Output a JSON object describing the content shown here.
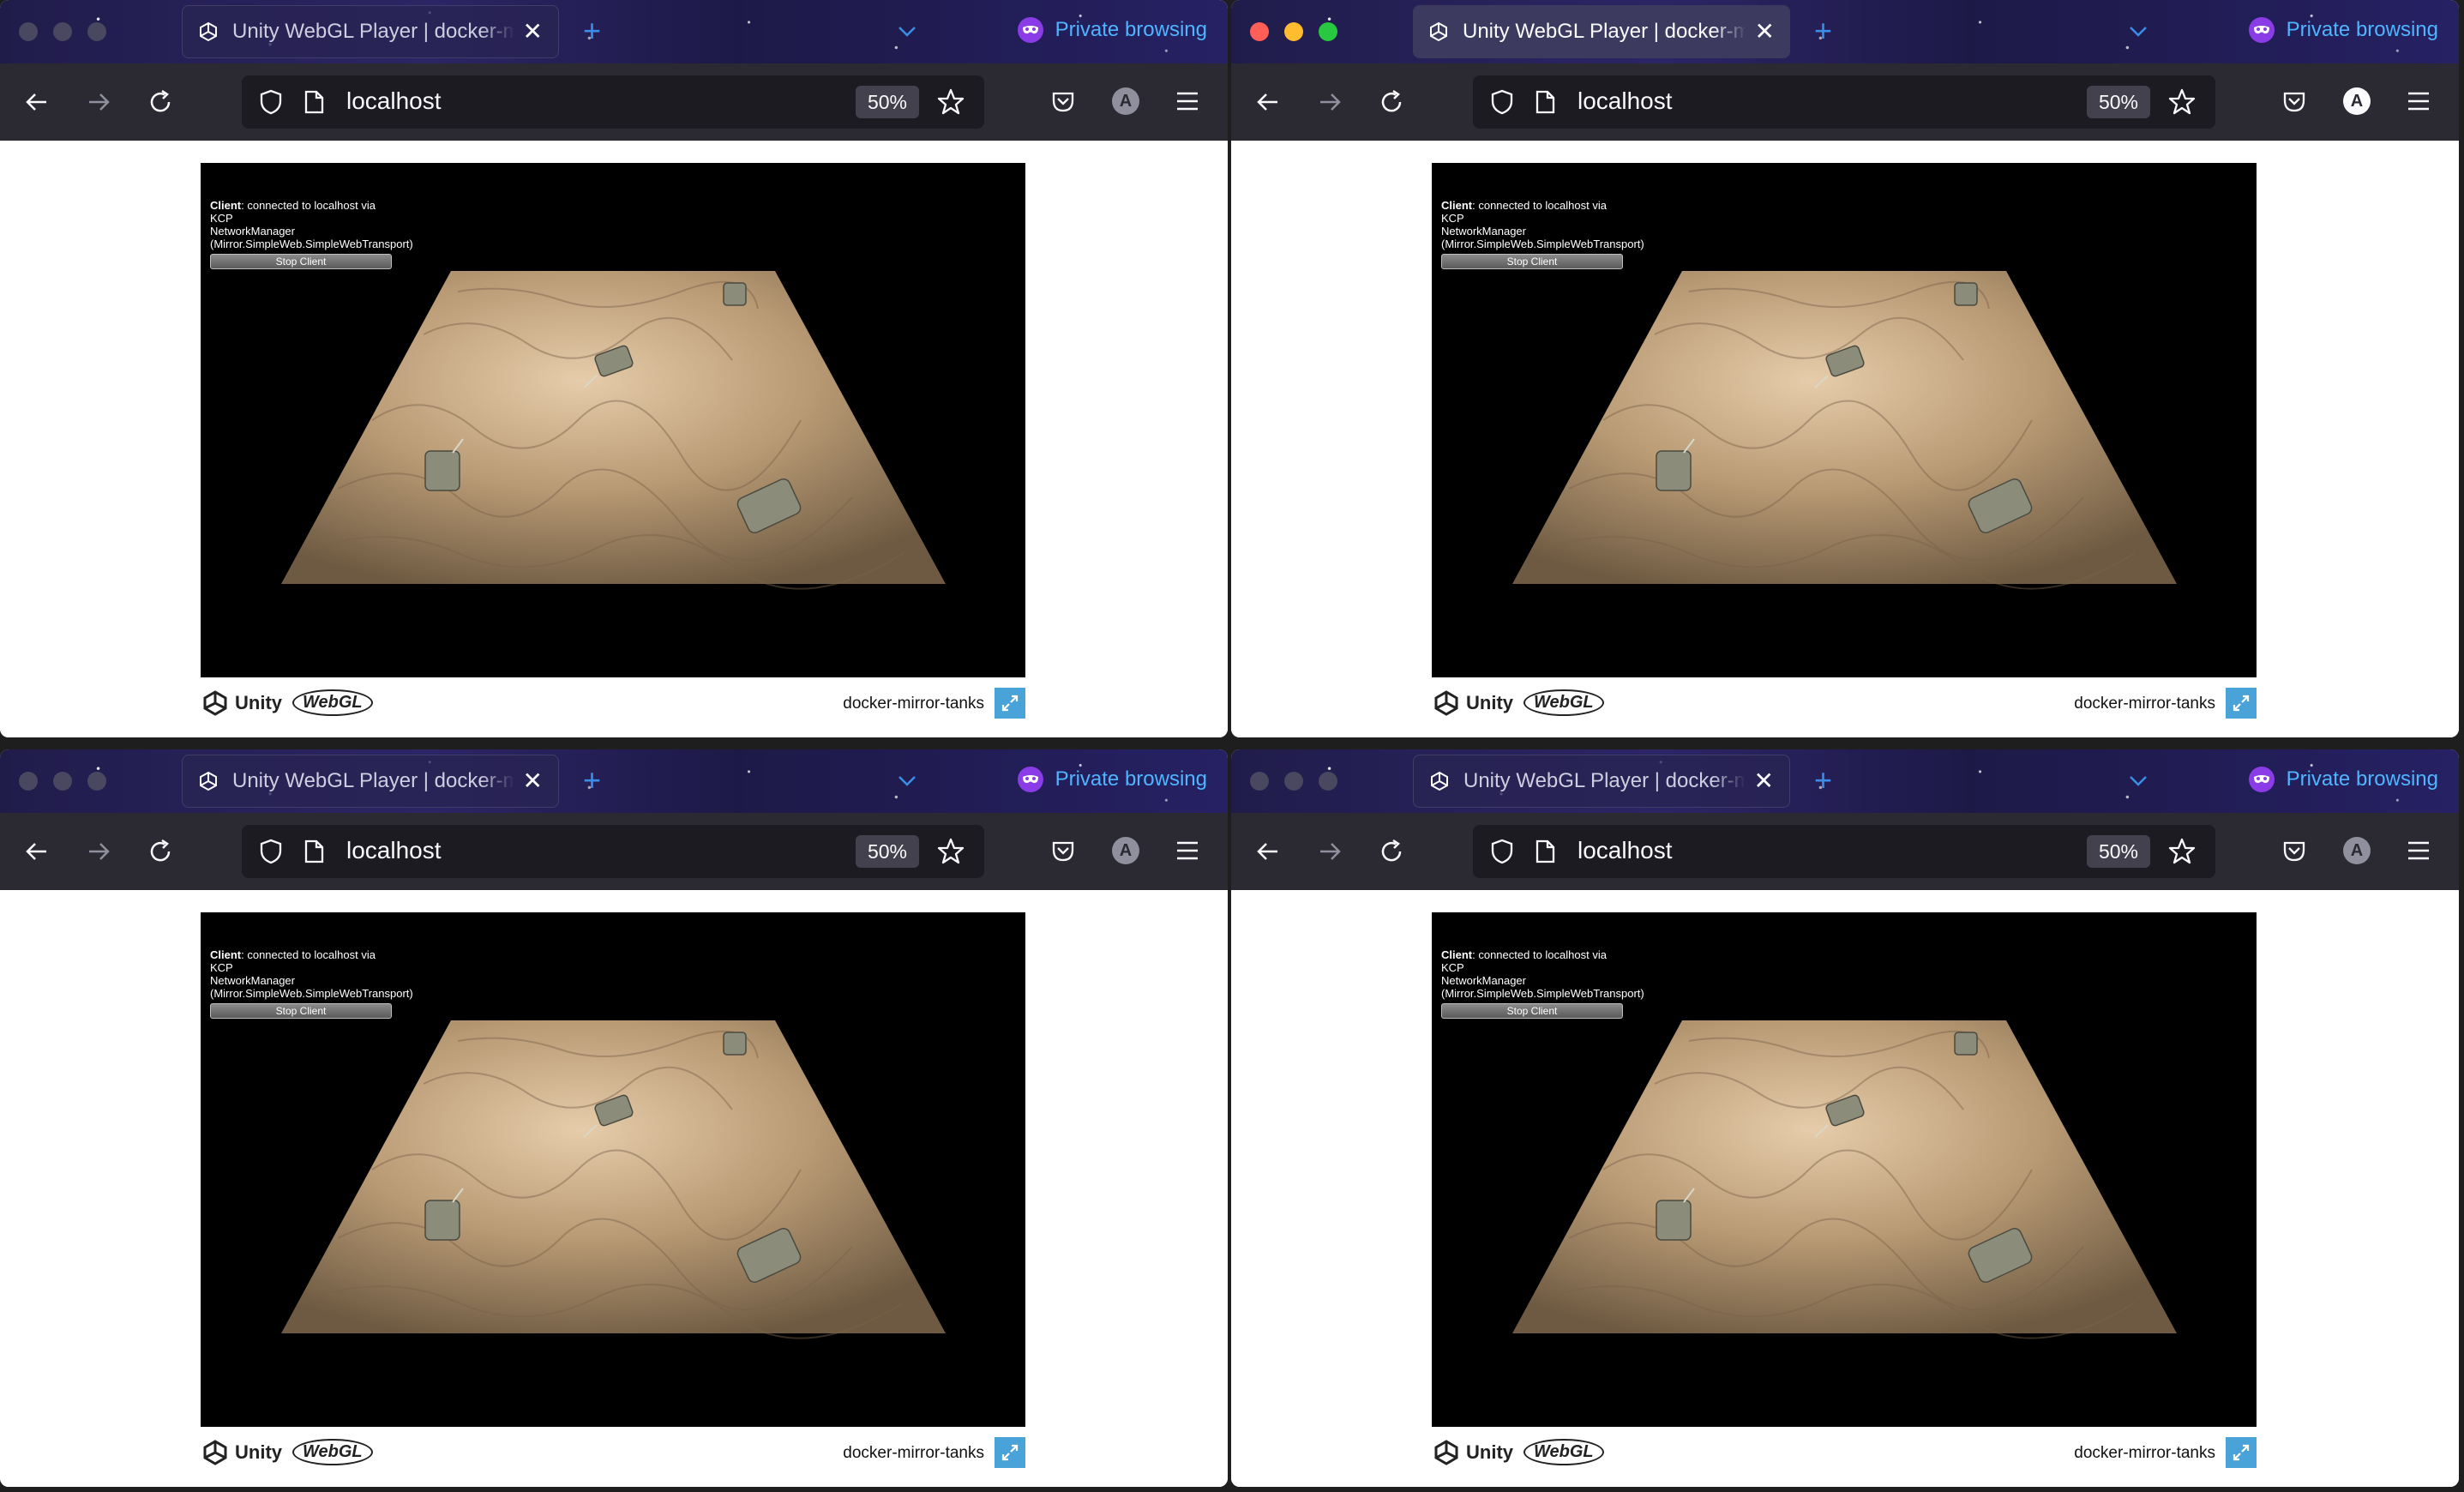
{
  "windows": [
    {
      "id": "win-0",
      "state": "inactive"
    },
    {
      "id": "win-1",
      "state": "active"
    },
    {
      "id": "win-2",
      "state": "inactive"
    },
    {
      "id": "win-3",
      "state": "inactive"
    }
  ],
  "browser": {
    "tab_title": "Unity WebGL Player | docker-mirror-tanks",
    "tab_close": "✕",
    "new_tab": "+",
    "private_label": "Private browsing",
    "url": "localhost",
    "zoom": "50%"
  },
  "game": {
    "hud_client_label": "Client",
    "hud_status": ": connected to localhost via KCP",
    "hud_manager": "NetworkManager (Mirror.SimpleWeb.SimpleWebTransport)",
    "stop_button": "Stop Client"
  },
  "footer": {
    "unity_label": "Unity",
    "webgl_label": "WebGL",
    "build_title": "docker-mirror-tanks"
  },
  "colors": {
    "private_accent": "#4fb5ff",
    "fullscreen_button": "#4aa3d8",
    "ground": "#b89a74"
  }
}
